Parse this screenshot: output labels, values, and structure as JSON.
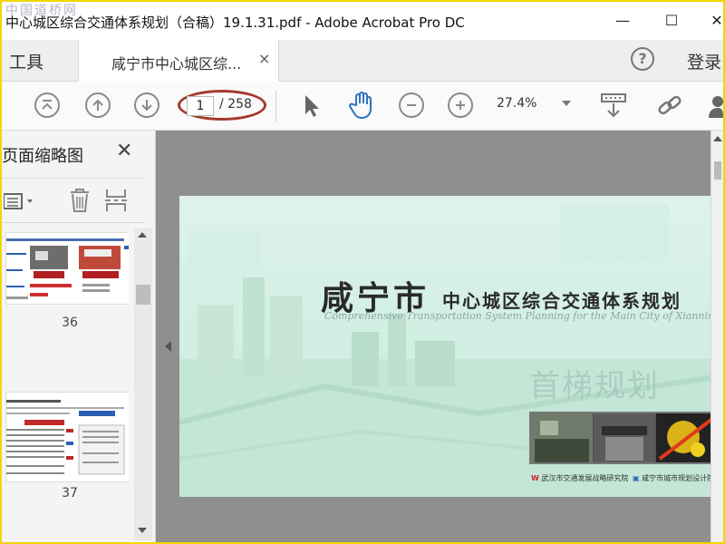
{
  "watermark": "中国道桥网",
  "window": {
    "title": "中心城区综合交通体系规划（合稿）19.1.31.pdf - Adobe Acrobat Pro DC",
    "minimize": "—",
    "maximize": "☐",
    "close": "✕"
  },
  "tabs": {
    "tools": "工具",
    "document": "咸宁市中心城区综...",
    "document_close": "×",
    "help": "?",
    "login": "登录"
  },
  "toolbar": {
    "current_page": "1",
    "total_pages": "/ 258",
    "zoom": "27.4%",
    "highlight_color": "#a33a2a",
    "icons": [
      "first-page-icon",
      "previous-page-icon",
      "next-page-icon",
      "select-cursor-icon",
      "hand-tool-icon",
      "zoom-out-icon",
      "zoom-in-icon",
      "scrolling-mode-icon",
      "link-icon",
      "share-icon"
    ]
  },
  "sidebar": {
    "title": "页面缩略图",
    "close": "✕",
    "thumbnails": [
      {
        "label": "36"
      },
      {
        "label": "37"
      }
    ]
  },
  "document": {
    "title_main": "咸宁市",
    "title_sub": "中心城区综合交通体系规划",
    "title_en": "Comprehensive Transportation System Planning for the Main City of Xianning",
    "watermark": "首梯规划",
    "org_1": "武汉市交通发展战略研究院",
    "org_2": "咸宁市城市规划设计院"
  }
}
